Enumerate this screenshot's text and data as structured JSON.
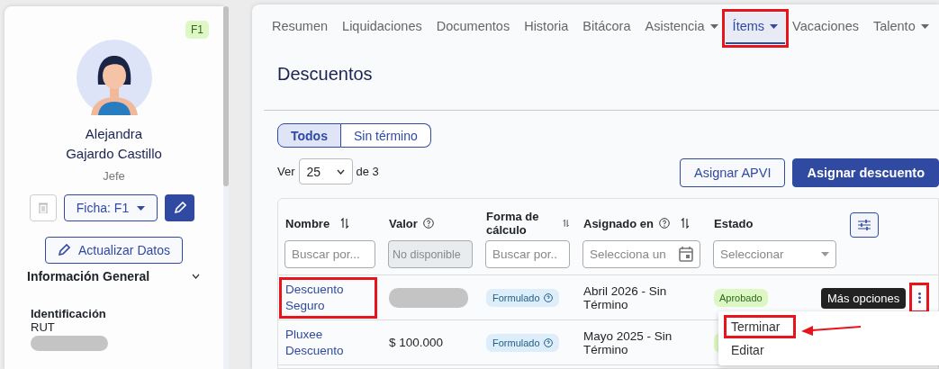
{
  "profile": {
    "badge": "F1",
    "first_name": "Alejandra",
    "last_name": "Gajardo Castillo",
    "role": "Jefe",
    "ficha_button": "Ficha: F1",
    "update_button": "Actualizar Datos",
    "section": {
      "title": "Información General",
      "expanded": true
    },
    "fields": [
      {
        "label": "Identificación",
        "sublabel": "RUT",
        "masked": true
      }
    ]
  },
  "tabs": [
    {
      "label": "Resumen",
      "selected": false,
      "dropdown": false,
      "highlighted": false
    },
    {
      "label": "Liquidaciones",
      "selected": false,
      "dropdown": false,
      "highlighted": false
    },
    {
      "label": "Documentos",
      "selected": false,
      "dropdown": false,
      "highlighted": false
    },
    {
      "label": "Historia",
      "selected": false,
      "dropdown": false,
      "highlighted": false
    },
    {
      "label": "Bitácora",
      "selected": false,
      "dropdown": false,
      "highlighted": false
    },
    {
      "label": "Asistencia",
      "selected": false,
      "dropdown": true,
      "highlighted": false
    },
    {
      "label": "Ítems",
      "selected": true,
      "dropdown": true,
      "highlighted": true
    },
    {
      "label": "Vacaciones",
      "selected": false,
      "dropdown": false,
      "highlighted": false
    },
    {
      "label": "Talento",
      "selected": false,
      "dropdown": true,
      "highlighted": false
    }
  ],
  "page_title": "Descuentos",
  "filters": [
    {
      "label": "Todos",
      "selected": true
    },
    {
      "label": "Sin término",
      "selected": false
    }
  ],
  "pager": {
    "prefix": "Ver",
    "page_size": "25",
    "suffix": "de 3"
  },
  "actions": [
    {
      "label": "Asignar APVI",
      "kind": "outline"
    },
    {
      "label": "Asignar descuento",
      "kind": "primary"
    }
  ],
  "table": {
    "columns": [
      {
        "title": "Nombre",
        "sortable": true,
        "filter": {
          "kind": "text",
          "placeholder": "Buscar por..."
        }
      },
      {
        "title": "Valor",
        "help": true,
        "filter": {
          "kind": "disabled",
          "placeholder": "No disponible"
        }
      },
      {
        "title": "Forma de cálculo",
        "sortable": true,
        "filter": {
          "kind": "text",
          "placeholder": "Buscar por.."
        }
      },
      {
        "title": "Asignado en",
        "help": true,
        "sortable": true,
        "filter": {
          "kind": "date",
          "placeholder": "Selecciona un"
        }
      },
      {
        "title": "Estado",
        "filter": {
          "kind": "select",
          "placeholder": "Seleccionar"
        }
      }
    ],
    "rows": [
      {
        "name": "Descuento Seguro",
        "name_highlighted": true,
        "masked": true,
        "method": "Formulado",
        "assigned": "Abril 2026 - Sin Término",
        "status": "Aprobado",
        "menu_highlighted": true
      },
      {
        "name": "Pluxee Descuento",
        "name_highlighted": false,
        "value": "$ 100.000",
        "masked": false,
        "method": "Formulado",
        "assigned": "Mayo 2025 - Sin Término",
        "status_covered": true
      }
    ]
  },
  "tooltip": "Más opciones",
  "menu": [
    {
      "label": "Terminar",
      "highlighted": true
    },
    {
      "label": "Editar",
      "highlighted": false
    }
  ]
}
